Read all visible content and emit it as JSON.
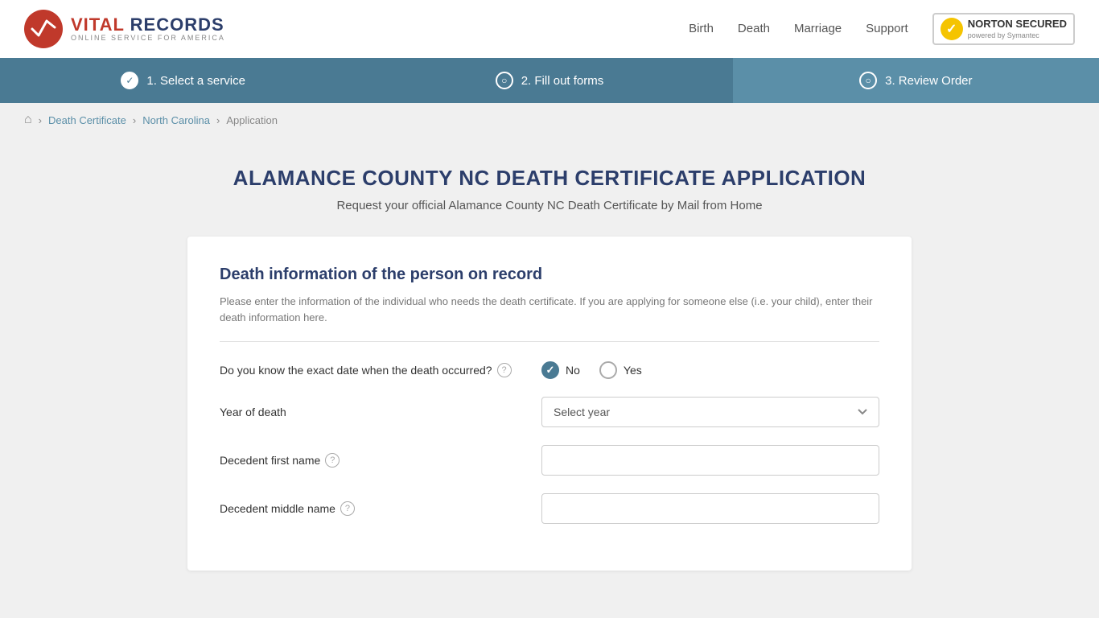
{
  "header": {
    "logo_vital": "VITAL",
    "logo_records": "RECORDS",
    "logo_subtitle": "ONLINE SERVICE FOR AMERICA",
    "nav": {
      "birth": "Birth",
      "death": "Death",
      "marriage": "Marriage",
      "support": "Support"
    },
    "norton_secured": "NORTON",
    "norton_line2": "SECURED",
    "norton_powered": "powered by Symantec"
  },
  "steps": [
    {
      "number": "1",
      "label": "1. Select a service",
      "state": "completed"
    },
    {
      "number": "2",
      "label": "2. Fill out forms",
      "state": "active"
    },
    {
      "number": "3",
      "label": "3. Review Order",
      "state": "inactive"
    }
  ],
  "breadcrumb": {
    "home_icon": "⌂",
    "items": [
      "Death Certificate",
      "North Carolina",
      "Application"
    ]
  },
  "page": {
    "main_title": "ALAMANCE COUNTY NC DEATH CERTIFICATE APPLICATION",
    "subtitle": "Request your official Alamance County NC Death Certificate by Mail from Home"
  },
  "form": {
    "section_title": "Death information of the person on record",
    "section_desc": "Please enter the information of the individual who needs the death certificate. If you are applying for someone else (i.e. your child), enter their death information here.",
    "fields": {
      "exact_date_question": "Do you know the exact date when the death occurred?",
      "exact_date_no": "No",
      "exact_date_yes": "Yes",
      "exact_date_selected": "No",
      "year_of_death_label": "Year of death",
      "year_of_death_placeholder": "Select year",
      "decedent_first_name_label": "Decedent first name",
      "decedent_first_name_value": "",
      "decedent_middle_name_label": "Decedent middle name",
      "decedent_middle_name_value": ""
    }
  }
}
